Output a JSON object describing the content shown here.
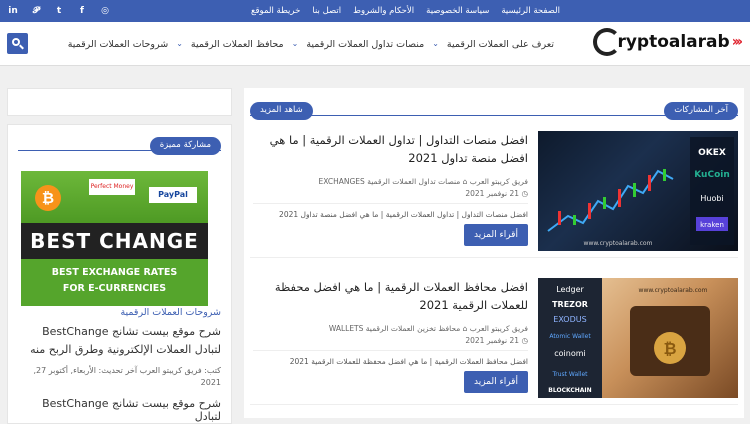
{
  "topbar": {
    "links": [
      "الصفحة الرئيسية",
      "سياسة الخصوصية",
      "الأحكام والشروط",
      "اتصل بنا",
      "خريطة الموقع"
    ],
    "social": [
      "in",
      "𝓟",
      "t",
      "f",
      "◎"
    ]
  },
  "header": {
    "logo_text": "ryptoalarab",
    "nav": [
      "تعرف على العملات الرقمية",
      "منصات تداول العملات الرقمية",
      "محافظ العملات الرقمية",
      "شروحات العملات الرقمية"
    ]
  },
  "main": {
    "latest_label": "آخر المشاركات",
    "see_more_label": "شاهد المزيد",
    "posts": [
      {
        "title": "افضل منصات التداول | تداول العملات الرقمية | ما هي افضل منصة تداول 2021",
        "author": "فريق كريبتو العرب",
        "category": "منصات تداول العملات الرقمية EXCHANGES",
        "date": "21 نوفمبر 2021",
        "excerpt": "افضل منصات التداول | تداول العملات الرقمية | ما هي افضل منصة تداول 2021",
        "more": "أقراء المزيد",
        "image_labels": [
          "OKEX",
          "KuCoin",
          "Huobi",
          "kraken",
          "www.cryptoalarab.com"
        ]
      },
      {
        "title": "افضل محافظ العملات الرقمية | ما هي افضل محفظة للعملات الرقمية 2021",
        "author": "فريق كريبتو العرب",
        "category": "محافظ تخزين العملات الرقمية WALLETS",
        "date": "21 نوفمبر 2021",
        "excerpt": "افضل محافظ العملات الرقمية | ما هي افضل محفظة للعملات الرقمية 2021",
        "more": "أقراء المزيد",
        "image_labels": [
          "Ledger",
          "TREZOR",
          "EXODUS",
          "Atomic Wallet",
          "coinomi",
          "Trust Wallet",
          "BLOCKCHAIN",
          "www.cryptoalarab.com"
        ]
      }
    ]
  },
  "sidebar": {
    "featured_label": "مشاركة مميزة",
    "image": {
      "band": "BEST CHANGE",
      "bottom1": "BEST EXCHANGE RATES",
      "bottom2": "FOR E-CURRENCIES",
      "pm": "Perfect Money",
      "paypal": "PayPal"
    },
    "category": "شروحات العملات الرقمية",
    "title": "شرح موقع بيست تشانج BestChange لتبادل العملات الإلكترونية وطرق الربح منه",
    "meta": "كتب: فريق كريبتو العرب آخر تحديث: الأربعاء, أكتوبر 27, 2021",
    "title2": "شرح موقع بيست تشانج BestChange لتبادل"
  }
}
